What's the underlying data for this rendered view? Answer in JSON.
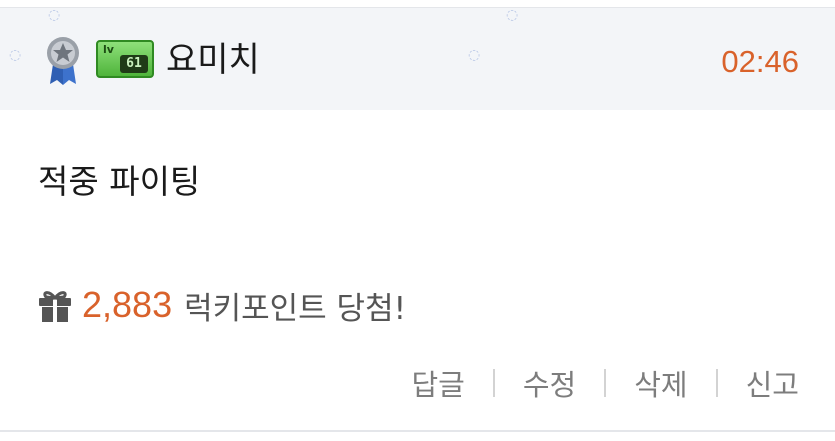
{
  "header": {
    "username": "요미치",
    "time": "02:46",
    "level_badge": {
      "prefix": "lv",
      "level": "61"
    },
    "icons": [
      "medal-icon",
      "level-badge-icon"
    ]
  },
  "comment": {
    "text": "적중 파이팅"
  },
  "prize": {
    "icon": "gift-icon",
    "amount": "2,883",
    "text": "럭키포인트 당첨!"
  },
  "actions": {
    "reply": "답글",
    "edit": "수정",
    "delete": "삭제",
    "report": "신고"
  },
  "colors": {
    "accent": "#d9622b",
    "header_bg": "#f3f5f8",
    "text": "#1a1a1a",
    "muted": "#7d7d7d",
    "badge_green": "#4fb43b"
  }
}
